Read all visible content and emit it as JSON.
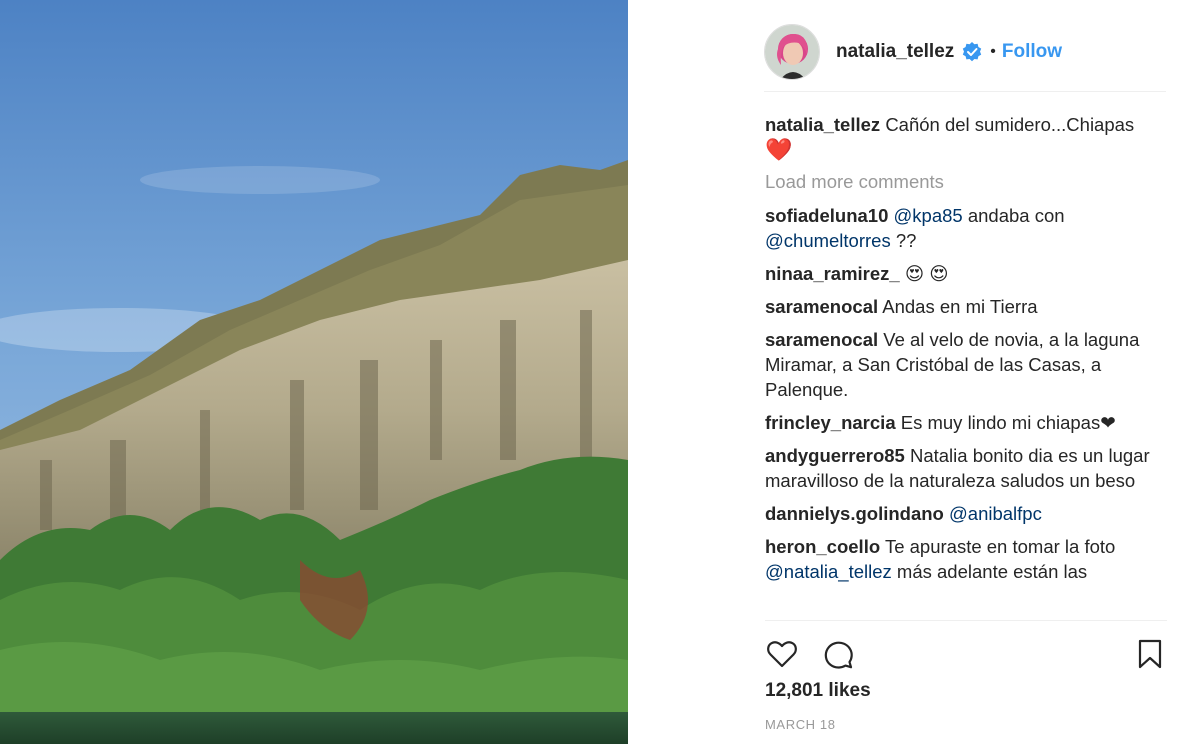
{
  "post": {
    "username": "natalia_tellez",
    "follow_label": "Follow",
    "separator": "•",
    "caption_text": "Cañón del sumidero...Chiapas",
    "caption_emoji": "❤️",
    "load_more_label": "Load more comments",
    "likes": "12,801 likes",
    "date": "MARCH 18"
  },
  "comments": [
    {
      "user": "sofiadeluna10",
      "mention1": "@kpa85",
      "text1": " andaba con ",
      "mention2": "@chumeltorres",
      "text2": " ??"
    },
    {
      "user": "ninaa_ramirez_",
      "text": "😍 😍"
    },
    {
      "user": "saramenocal",
      "text": "Andas en mi Tierra"
    },
    {
      "user": "saramenocal",
      "text": "Ve al velo de novia, a la laguna Miramar, a San Cristóbal de las Casas, a Palenque."
    },
    {
      "user": "frincley_narcia",
      "text": "Es muy lindo mi chiapas❤"
    },
    {
      "user": "andyguerrero85",
      "text": "Natalia bonito dia es un lugar maravilloso de la naturaleza saludos un beso"
    },
    {
      "user": "dannielys.golindano",
      "mention": "@anibalfpc"
    },
    {
      "user": "heron_coello",
      "text": "Te apuraste en tomar la foto",
      "mention": "@natalia_tellez",
      "text2": " más adelante están las"
    }
  ],
  "icons": {
    "like": "heart-outline-icon",
    "comment": "comment-bubble-icon",
    "save": "bookmark-icon",
    "verified": "verified-badge-icon"
  },
  "colors": {
    "accent": "#3897f0",
    "mention": "#003569",
    "muted": "#999999",
    "text": "#262626"
  }
}
